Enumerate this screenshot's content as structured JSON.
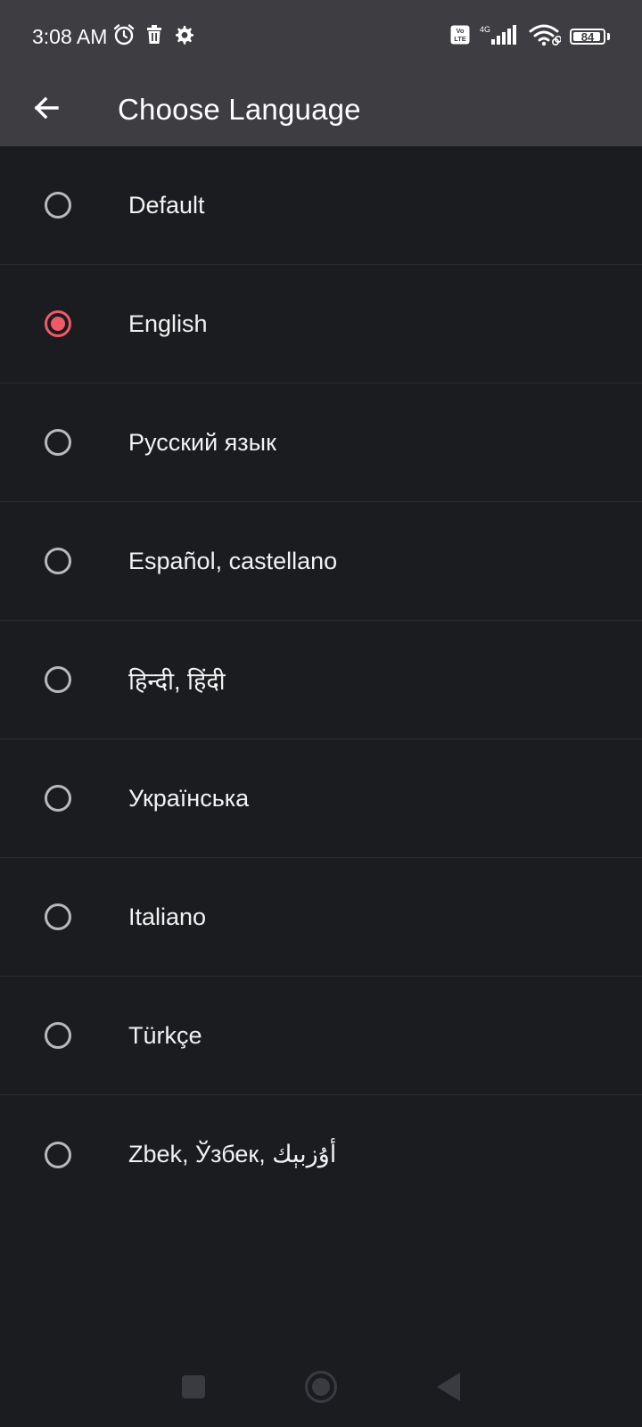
{
  "status_bar": {
    "time": "3:08 AM",
    "left_icons": [
      "alarm-icon",
      "trash-icon",
      "gear-icon"
    ],
    "right_icons": [
      "volte-icon",
      "signal-4g-icon",
      "wifi-icon",
      "battery-icon"
    ],
    "network_label": "4G",
    "volte_label": "Vo LTE",
    "battery_level": "84"
  },
  "app_bar": {
    "back_icon": "arrow-back-icon",
    "title": "Choose Language"
  },
  "languages": [
    {
      "label": "Default",
      "selected": false
    },
    {
      "label": "English",
      "selected": true
    },
    {
      "label": "Русский язык",
      "selected": false
    },
    {
      "label": "Español, castellano",
      "selected": false
    },
    {
      "label": "हिन्दी, हिंदी",
      "selected": false
    },
    {
      "label": "Українська",
      "selected": false
    },
    {
      "label": "Italiano",
      "selected": false
    },
    {
      "label": "Türkçe",
      "selected": false
    },
    {
      "label": "Zbek, Ўзбек, أۇزبېك",
      "selected": false
    }
  ],
  "colors": {
    "background": "#1b1c20",
    "app_bar": "#3d3d42",
    "accent": "#f05a68",
    "radio_unselected": "#b9b9bc",
    "text": "#f2f2f2"
  },
  "nav_bar": {
    "buttons": [
      "recents-square-icon",
      "home-circle-icon",
      "back-triangle-icon"
    ]
  }
}
